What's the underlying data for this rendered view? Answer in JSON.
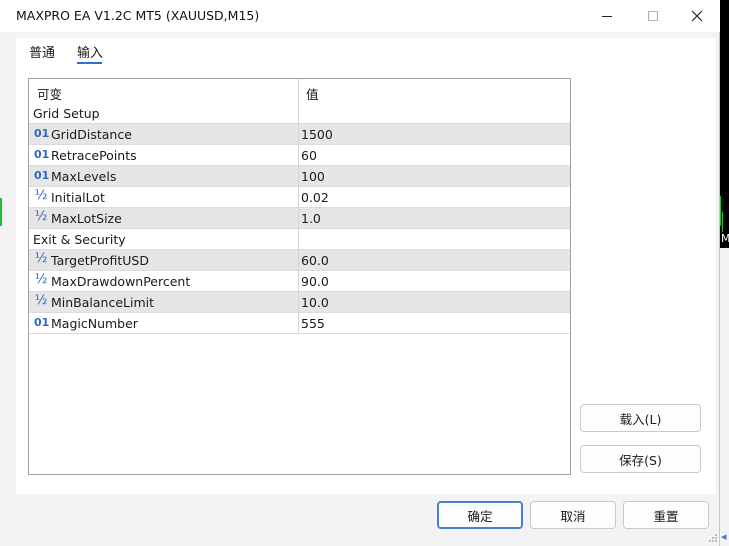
{
  "window": {
    "title": "MAXPRO EA V1.2C MT5 (XAUUSD,M15)"
  },
  "tabs": [
    {
      "label": "普通"
    },
    {
      "label": "输入"
    }
  ],
  "grid": {
    "headers": {
      "variable": "可变",
      "value": "值"
    },
    "rows": [
      {
        "type": "group",
        "name": "Grid Setup",
        "value": ""
      },
      {
        "type": "int",
        "icon": "01",
        "name": "GridDistance",
        "value": "1500"
      },
      {
        "type": "int",
        "icon": "01",
        "name": "RetracePoints",
        "value": "60"
      },
      {
        "type": "int",
        "icon": "01",
        "name": "MaxLevels",
        "value": "100"
      },
      {
        "type": "double",
        "icon": "½",
        "name": "InitialLot",
        "value": "0.02"
      },
      {
        "type": "double",
        "icon": "½",
        "name": "MaxLotSize",
        "value": "1.0"
      },
      {
        "type": "group",
        "name": "Exit & Security",
        "value": ""
      },
      {
        "type": "double",
        "icon": "½",
        "name": "TargetProfitUSD",
        "value": "60.0"
      },
      {
        "type": "double",
        "icon": "½",
        "name": "MaxDrawdownPercent",
        "value": "90.0"
      },
      {
        "type": "double",
        "icon": "½",
        "name": "MinBalanceLimit",
        "value": "10.0"
      },
      {
        "type": "int",
        "icon": "01",
        "name": "MagicNumber",
        "value": "555"
      }
    ]
  },
  "side_buttons": {
    "load": "载入(L)",
    "save": "保存(S)"
  },
  "footer": {
    "ok": "确定",
    "cancel": "取消",
    "reset": "重置"
  },
  "background": {
    "chart_label": "M"
  }
}
